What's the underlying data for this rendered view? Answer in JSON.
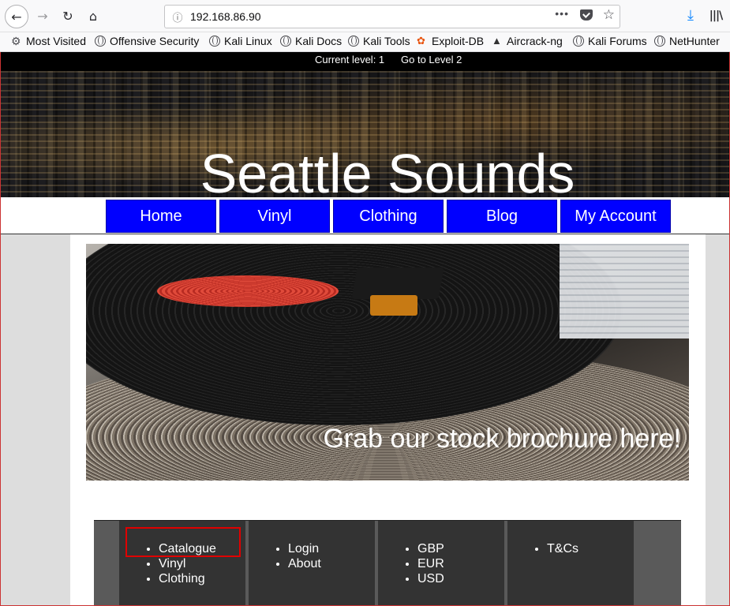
{
  "browser": {
    "url": "192.168.86.90",
    "bookmarks": [
      "Most Visited",
      "Offensive Security",
      "Kali Linux",
      "Kali Docs",
      "Kali Tools",
      "Exploit-DB",
      "Aircrack-ng",
      "Kali Forums",
      "NetHunter"
    ]
  },
  "level_bar": {
    "current": "Current level: 1",
    "next": "Go to Level 2"
  },
  "site": {
    "title": "Seattle Sounds"
  },
  "menu": [
    "Home",
    "Vinyl",
    "Clothing",
    "Blog",
    "My Account"
  ],
  "banner": {
    "text": "Grab our stock brochure here!"
  },
  "footer": {
    "columns": [
      [
        "Catalogue",
        "Vinyl",
        "Clothing"
      ],
      [
        "Login",
        "About"
      ],
      [
        "GBP",
        "EUR",
        "USD"
      ],
      [
        "T&Cs"
      ]
    ]
  },
  "colors": {
    "menu_bg": "#0000ff",
    "footer_bg": "#333333",
    "highlight": "#e00000"
  }
}
